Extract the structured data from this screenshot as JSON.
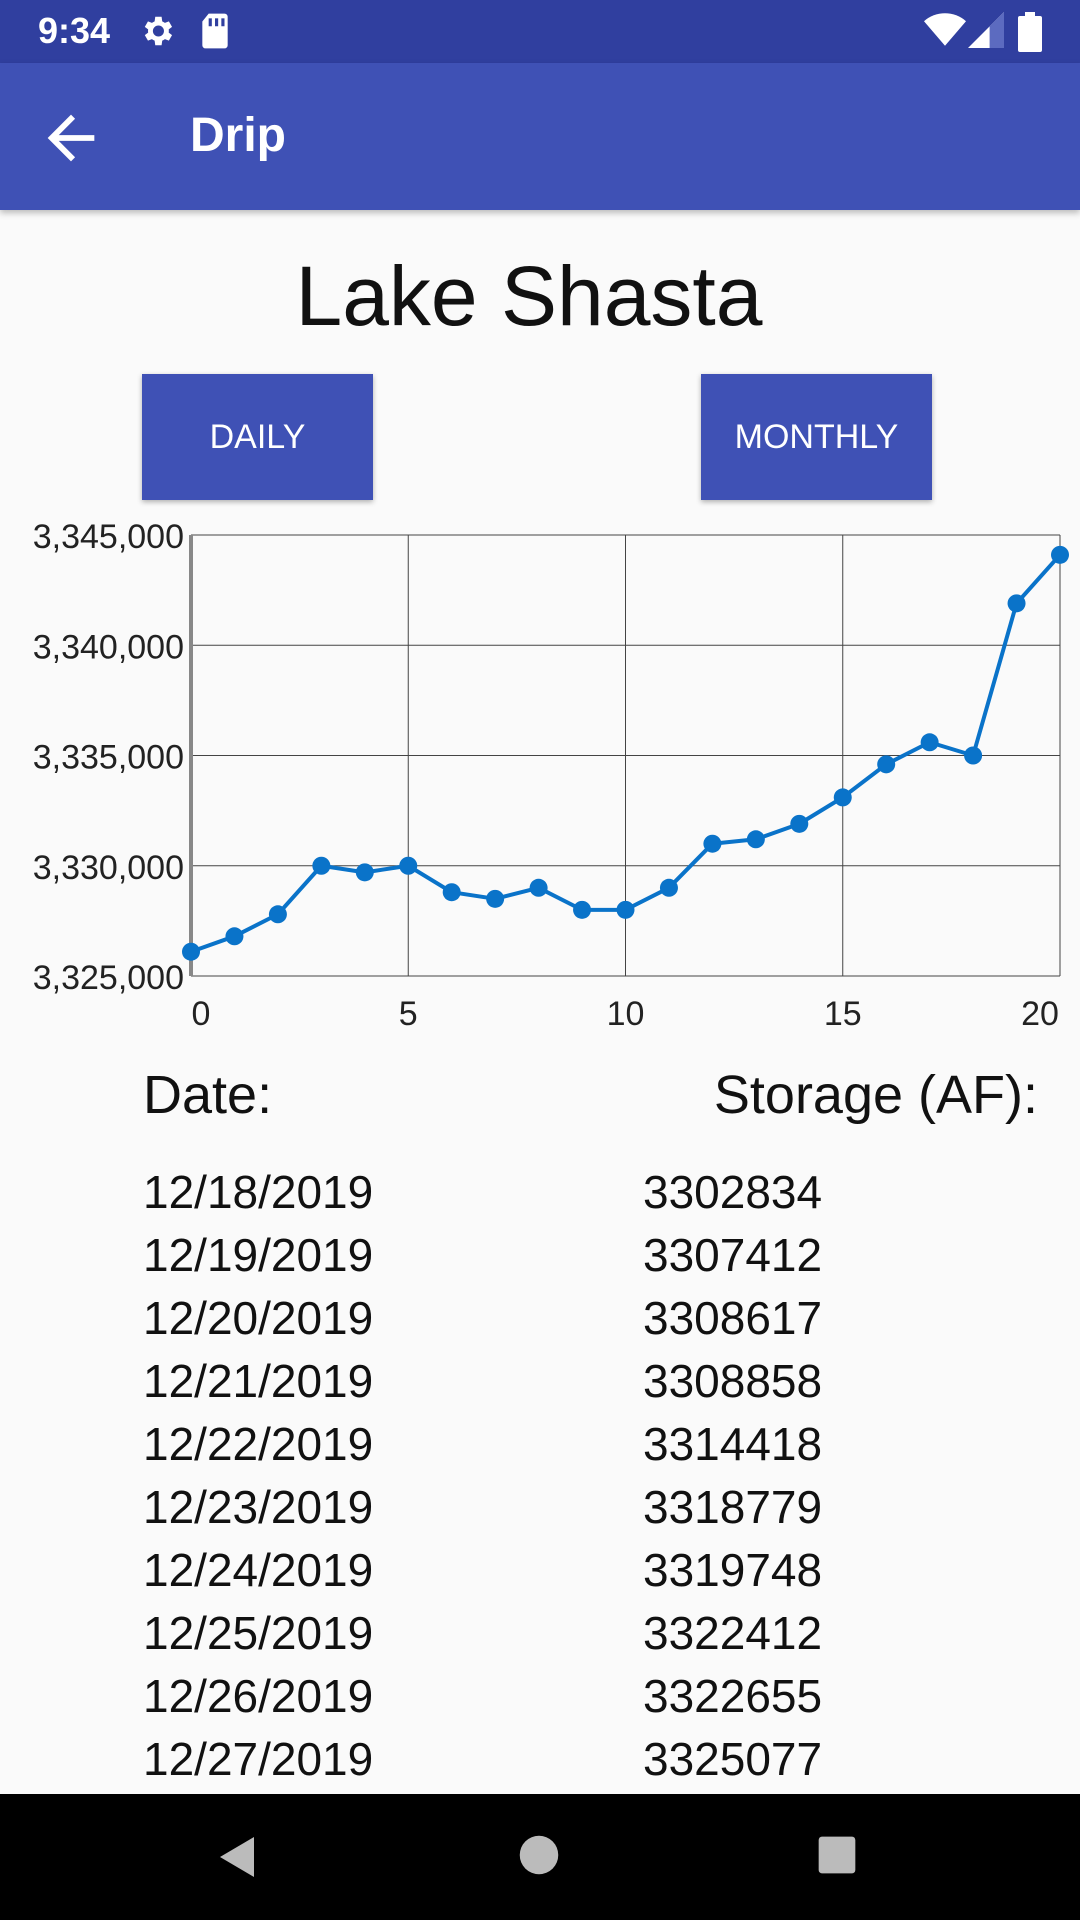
{
  "status_bar": {
    "time": "9:34",
    "icons": [
      "settings-icon",
      "sd-card-icon",
      "wifi-icon",
      "signal-icon",
      "battery-icon"
    ]
  },
  "app_bar": {
    "title": "Drip",
    "back_icon": "arrow-back-icon"
  },
  "lake_title": "Lake Shasta",
  "buttons": {
    "daily": "DAILY",
    "monthly": "MONTHLY"
  },
  "colors": {
    "primary": "#3f51b5",
    "primary_dark": "#303f9f",
    "series": "#0a73c9"
  },
  "chart_data": {
    "type": "line",
    "x": [
      0,
      1,
      2,
      3,
      4,
      5,
      6,
      7,
      8,
      9,
      10,
      11,
      12,
      13,
      14,
      15,
      16,
      17,
      18,
      19,
      20
    ],
    "values": [
      3326100,
      3326800,
      3327800,
      3330000,
      3329700,
      3330000,
      3328800,
      3328500,
      3329000,
      3328000,
      3328000,
      3329000,
      3331000,
      3331200,
      3331900,
      3333100,
      3334600,
      3335600,
      3335000,
      3341900,
      3344100
    ],
    "xlim": [
      0,
      20
    ],
    "ylim": [
      3325000,
      3345000
    ],
    "x_ticks": [
      "0",
      "5",
      "10",
      "15",
      "20"
    ],
    "y_ticks": [
      "3,345,000",
      "3,340,000",
      "3,335,000",
      "3,330,000",
      "3,325,000"
    ],
    "grid": true,
    "title": "",
    "xlabel": "",
    "ylabel": ""
  },
  "table": {
    "date_header": "Date:",
    "storage_header": "Storage (AF):",
    "rows": [
      {
        "date": "12/18/2019",
        "storage": "3302834"
      },
      {
        "date": "12/19/2019",
        "storage": "3307412"
      },
      {
        "date": "12/20/2019",
        "storage": "3308617"
      },
      {
        "date": "12/21/2019",
        "storage": "3308858"
      },
      {
        "date": "12/22/2019",
        "storage": "3314418"
      },
      {
        "date": "12/23/2019",
        "storage": "3318779"
      },
      {
        "date": "12/24/2019",
        "storage": "3319748"
      },
      {
        "date": "12/25/2019",
        "storage": "3322412"
      },
      {
        "date": "12/26/2019",
        "storage": "3322655"
      },
      {
        "date": "12/27/2019",
        "storage": "3325077"
      }
    ]
  },
  "nav_bar": {
    "back": "nav-back-icon",
    "home": "nav-home-icon",
    "recents": "nav-recents-icon"
  }
}
